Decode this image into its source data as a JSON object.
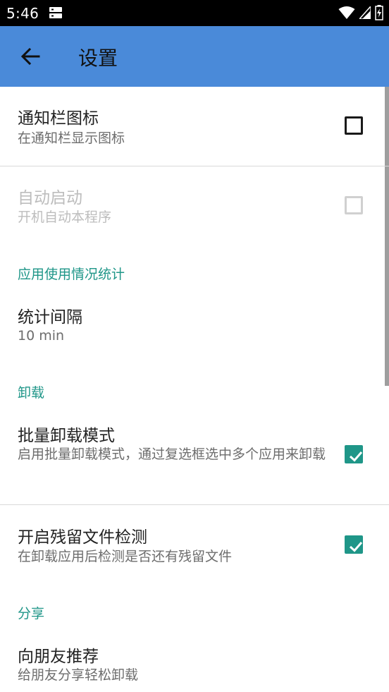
{
  "status_bar": {
    "time": "5:46",
    "icons": [
      "notification-icon",
      "wifi-icon",
      "signal-icon",
      "battery-charging-icon"
    ]
  },
  "app_bar": {
    "title": "设置",
    "back_icon": "arrow-back-icon"
  },
  "preferences": {
    "notification_icon": {
      "title": "通知栏图标",
      "summary": "在通知栏显示图标",
      "checked": false,
      "enabled": true
    },
    "auto_start": {
      "title": "自动启动",
      "summary": "开机自动本程序",
      "checked": false,
      "enabled": false
    },
    "usage_stats_category": "应用使用情况统计",
    "stats_interval": {
      "title": "统计间隔",
      "summary": "10 min"
    },
    "uninstall_category": "卸载",
    "batch_uninstall": {
      "title": "批量卸载模式",
      "summary": "启用批量卸载模式，通过复选框选中多个应用来卸载",
      "checked": true,
      "enabled": true
    },
    "residual_detect": {
      "title": "开启残留文件检测",
      "summary": "在卸载应用后检测是否还有残留文件",
      "checked": true,
      "enabled": true
    },
    "share_category": "分享",
    "recommend": {
      "title": "向朋友推荐",
      "summary": "给朋友分享轻松卸载"
    }
  },
  "colors": {
    "app_bar": "#4a8ad9",
    "accent": "#1f9688",
    "status_bar": "#000000"
  }
}
